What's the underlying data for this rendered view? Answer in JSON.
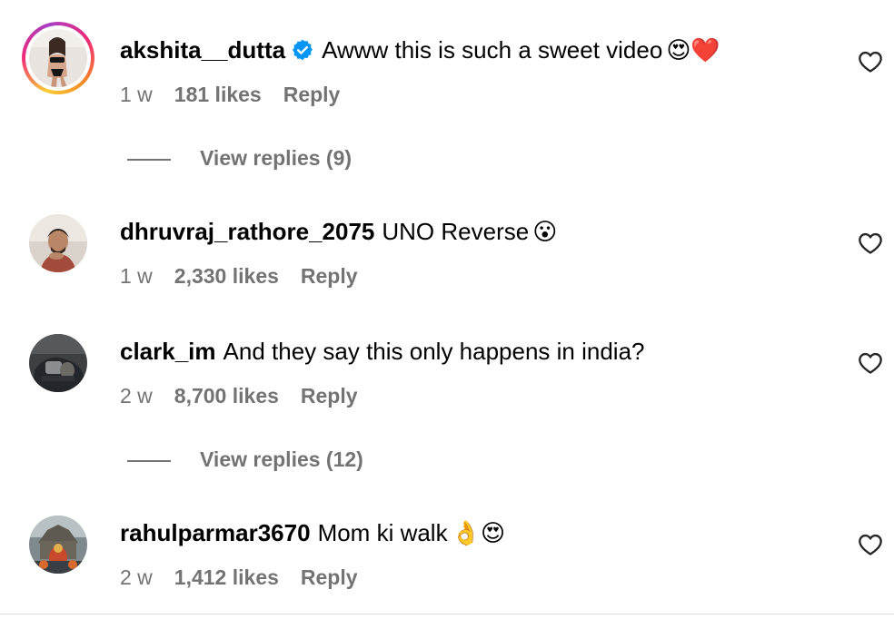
{
  "comments": [
    {
      "username": "akshita__dutta",
      "verified": true,
      "text": "Awww this is such a sweet video",
      "emoji": "😍❤️",
      "time": "1 w",
      "likes": "181 likes",
      "reply_label": "Reply",
      "view_replies": "View replies (9)",
      "avatar_icon": "profile-photo"
    },
    {
      "username": "dhruvraj_rathore_2075",
      "verified": false,
      "text": "UNO Reverse",
      "emoji": "😮",
      "time": "1 w",
      "likes": "2,330 likes",
      "reply_label": "Reply",
      "avatar_icon": "profile-photo"
    },
    {
      "username": "clark_im",
      "verified": false,
      "text": "And they say this only happens in india?",
      "emoji": "",
      "time": "2 w",
      "likes": "8,700 likes",
      "reply_label": "Reply",
      "view_replies": "View replies (12)",
      "avatar_icon": "profile-photo"
    },
    {
      "username": "rahulparmar3670",
      "verified": false,
      "text": "Mom ki walk",
      "emoji": "👌😍",
      "time": "2 w",
      "likes": "1,412 likes",
      "reply_label": "Reply",
      "avatar_icon": "profile-photo"
    }
  ],
  "icons": {
    "like": "heart-outline-icon",
    "verified": "verified-badge-icon"
  },
  "colors": {
    "text": "#000000",
    "secondary": "#737373",
    "verified": "#0095f6"
  }
}
